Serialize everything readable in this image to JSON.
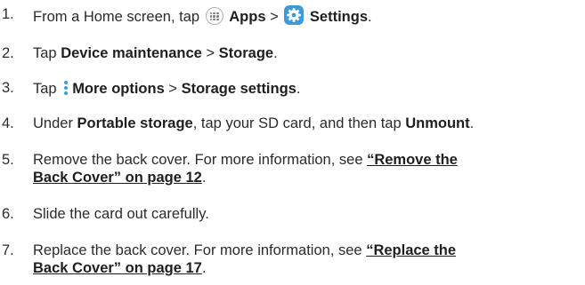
{
  "steps": [
    {
      "num": "1.",
      "a": "From a Home screen, tap ",
      "apps_label": "Apps",
      "sep": " > ",
      "settings_label": "Settings",
      "end": "."
    },
    {
      "num": "2.",
      "a": "Tap ",
      "b1": "Device maintenance",
      "sep": " > ",
      "b2": "Storage",
      "end": "."
    },
    {
      "num": "3.",
      "a": "Tap ",
      "b1": "More options",
      "sep": " > ",
      "b2": "Storage settings",
      "end": "."
    },
    {
      "num": "4.",
      "a": "Under ",
      "b1": "Portable storage",
      "mid": ", tap your SD card, and then tap ",
      "b2": "Unmount",
      "end": "."
    },
    {
      "num": "5.",
      "a": "Remove the back cover. For more information, see ",
      "link1": "“Remove the",
      "link2": "Back Cover” on page 12",
      "end": "."
    },
    {
      "num": "6.",
      "a": "Slide the card out carefully."
    },
    {
      "num": "7.",
      "a": "Replace the back cover. For more information, see ",
      "link1": "“Replace the",
      "link2": "Back Cover” on page 17",
      "end": "."
    }
  ],
  "icons": {
    "apps": "apps-icon",
    "settings": "settings-icon",
    "more_options": "more-options-icon"
  },
  "colors": {
    "text": "#2b2b2b",
    "settings_icon_bg": "#3e9ad6",
    "more_options_dots": "#3c9ee0"
  }
}
